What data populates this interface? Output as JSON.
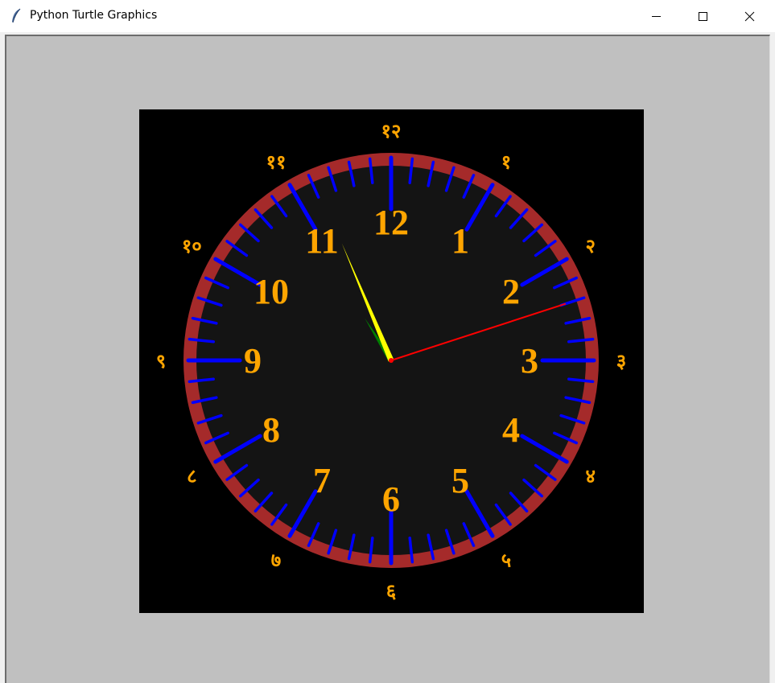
{
  "window": {
    "title": "Python Turtle Graphics",
    "controls": {
      "minimize": "minimize",
      "maximize": "maximize",
      "close": "close"
    }
  },
  "canvas": {
    "background": "#c0c0c0",
    "panel_color": "#000000"
  },
  "clock": {
    "colors": {
      "ring": "#a52a2a",
      "face": "#141414",
      "ticks": "#0000ff",
      "numerals": "#ffa500",
      "hour_hand": "#008000",
      "minute_hand": "#ffff00",
      "second_hand": "#ff0000"
    },
    "inner_numerals": [
      "12",
      "1",
      "2",
      "3",
      "4",
      "5",
      "6",
      "7",
      "8",
      "9",
      "10",
      "11"
    ],
    "outer_numerals": [
      "१२",
      "१",
      "२",
      "३",
      "४",
      "५",
      "६",
      "७",
      "८",
      "९",
      "१०",
      "११"
    ],
    "time": {
      "hour": 10,
      "minute": 56,
      "second": 12
    }
  }
}
